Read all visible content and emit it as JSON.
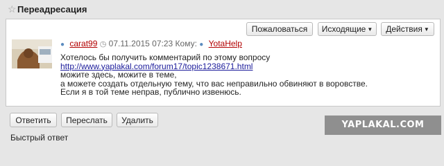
{
  "header": {
    "title": "Переадресация",
    "buttons": {
      "mark_read": "Пожаловаться",
      "outgoing": "Исходящие",
      "actions": "Действия"
    }
  },
  "message": {
    "sender": "carat99",
    "datetime": "07.11.2015 07:23",
    "to_label": "Кому:",
    "recipient": "YotaHelp",
    "lines": {
      "line1": "Хотелось бы получить комментарий по этому вопросу",
      "link": "http://www.yaplakal.com/forum17/topic1238671.html",
      "line3": "можите здесь, можите в теме,",
      "line4": "а можете создать отдельную тему, что вас неправильно обвиняют в воровстве.",
      "line5": "Если я в той теме неправ, публично извенюсь."
    }
  },
  "footer": {
    "reply": "Ответить",
    "forward": "Переслать",
    "delete": "Удалить",
    "quick_reply": "Быстрый ответ"
  },
  "watermark": "YAPLAKAL.COM",
  "icons": [
    "star-icon",
    "user-icon",
    "clock-icon",
    "caret-down-icon"
  ],
  "colors": {
    "link": "#1a1a9a",
    "user": "#b20000",
    "panel_bg": "#ffffff",
    "page_bg": "#e6e6e6"
  }
}
